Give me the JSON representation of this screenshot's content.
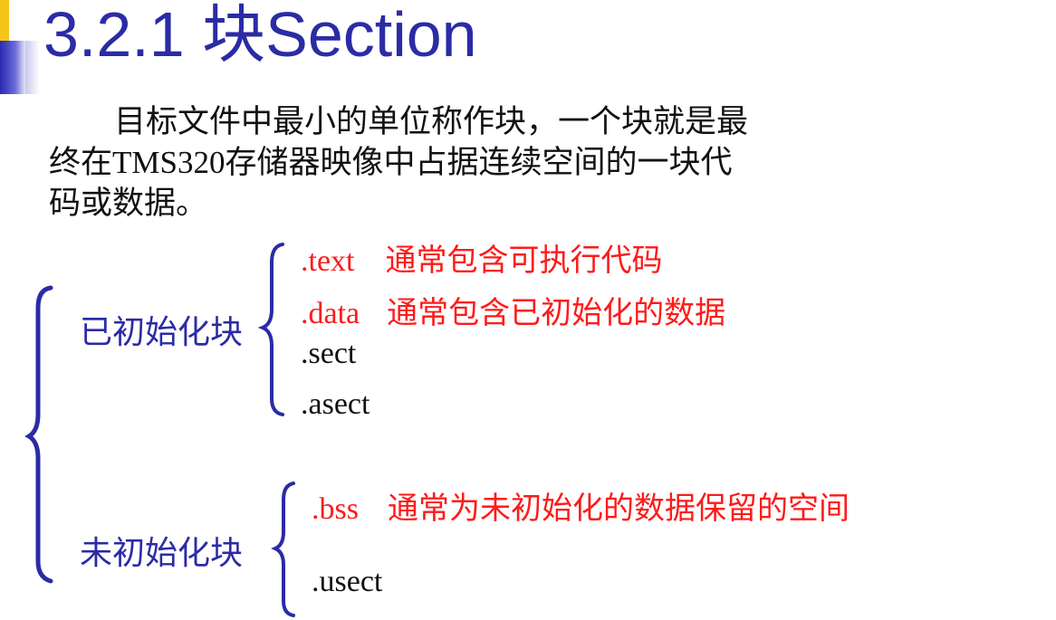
{
  "header": {
    "title": "3.2.1 块Section"
  },
  "intro": {
    "line1": "目标文件中最小的单位称作块，一个块就是最",
    "line2": "终在TMS320存储器映像中占据连续空间的一块代",
    "line3": "码或数据。"
  },
  "initialized": {
    "label": "已初始化块",
    "items": [
      {
        "directive": ".text",
        "description": "通常包含可执行代码"
      },
      {
        "directive": ".data",
        "description": "通常包含已初始化的数据"
      },
      {
        "directive": ".sect",
        "description": ""
      },
      {
        "directive": ".asect",
        "description": ""
      }
    ]
  },
  "uninitialized": {
    "label": "未初始化块",
    "items": [
      {
        "directive": ".bss",
        "description": "通常为未初始化的数据保留的空间"
      },
      {
        "directive": ".usect",
        "description": ""
      }
    ]
  },
  "colors": {
    "title": "#2b2ba6",
    "label": "#2b2ba6",
    "highlight": "#ff1a1a",
    "text": "#111111",
    "brace": "#2b2ba6"
  }
}
